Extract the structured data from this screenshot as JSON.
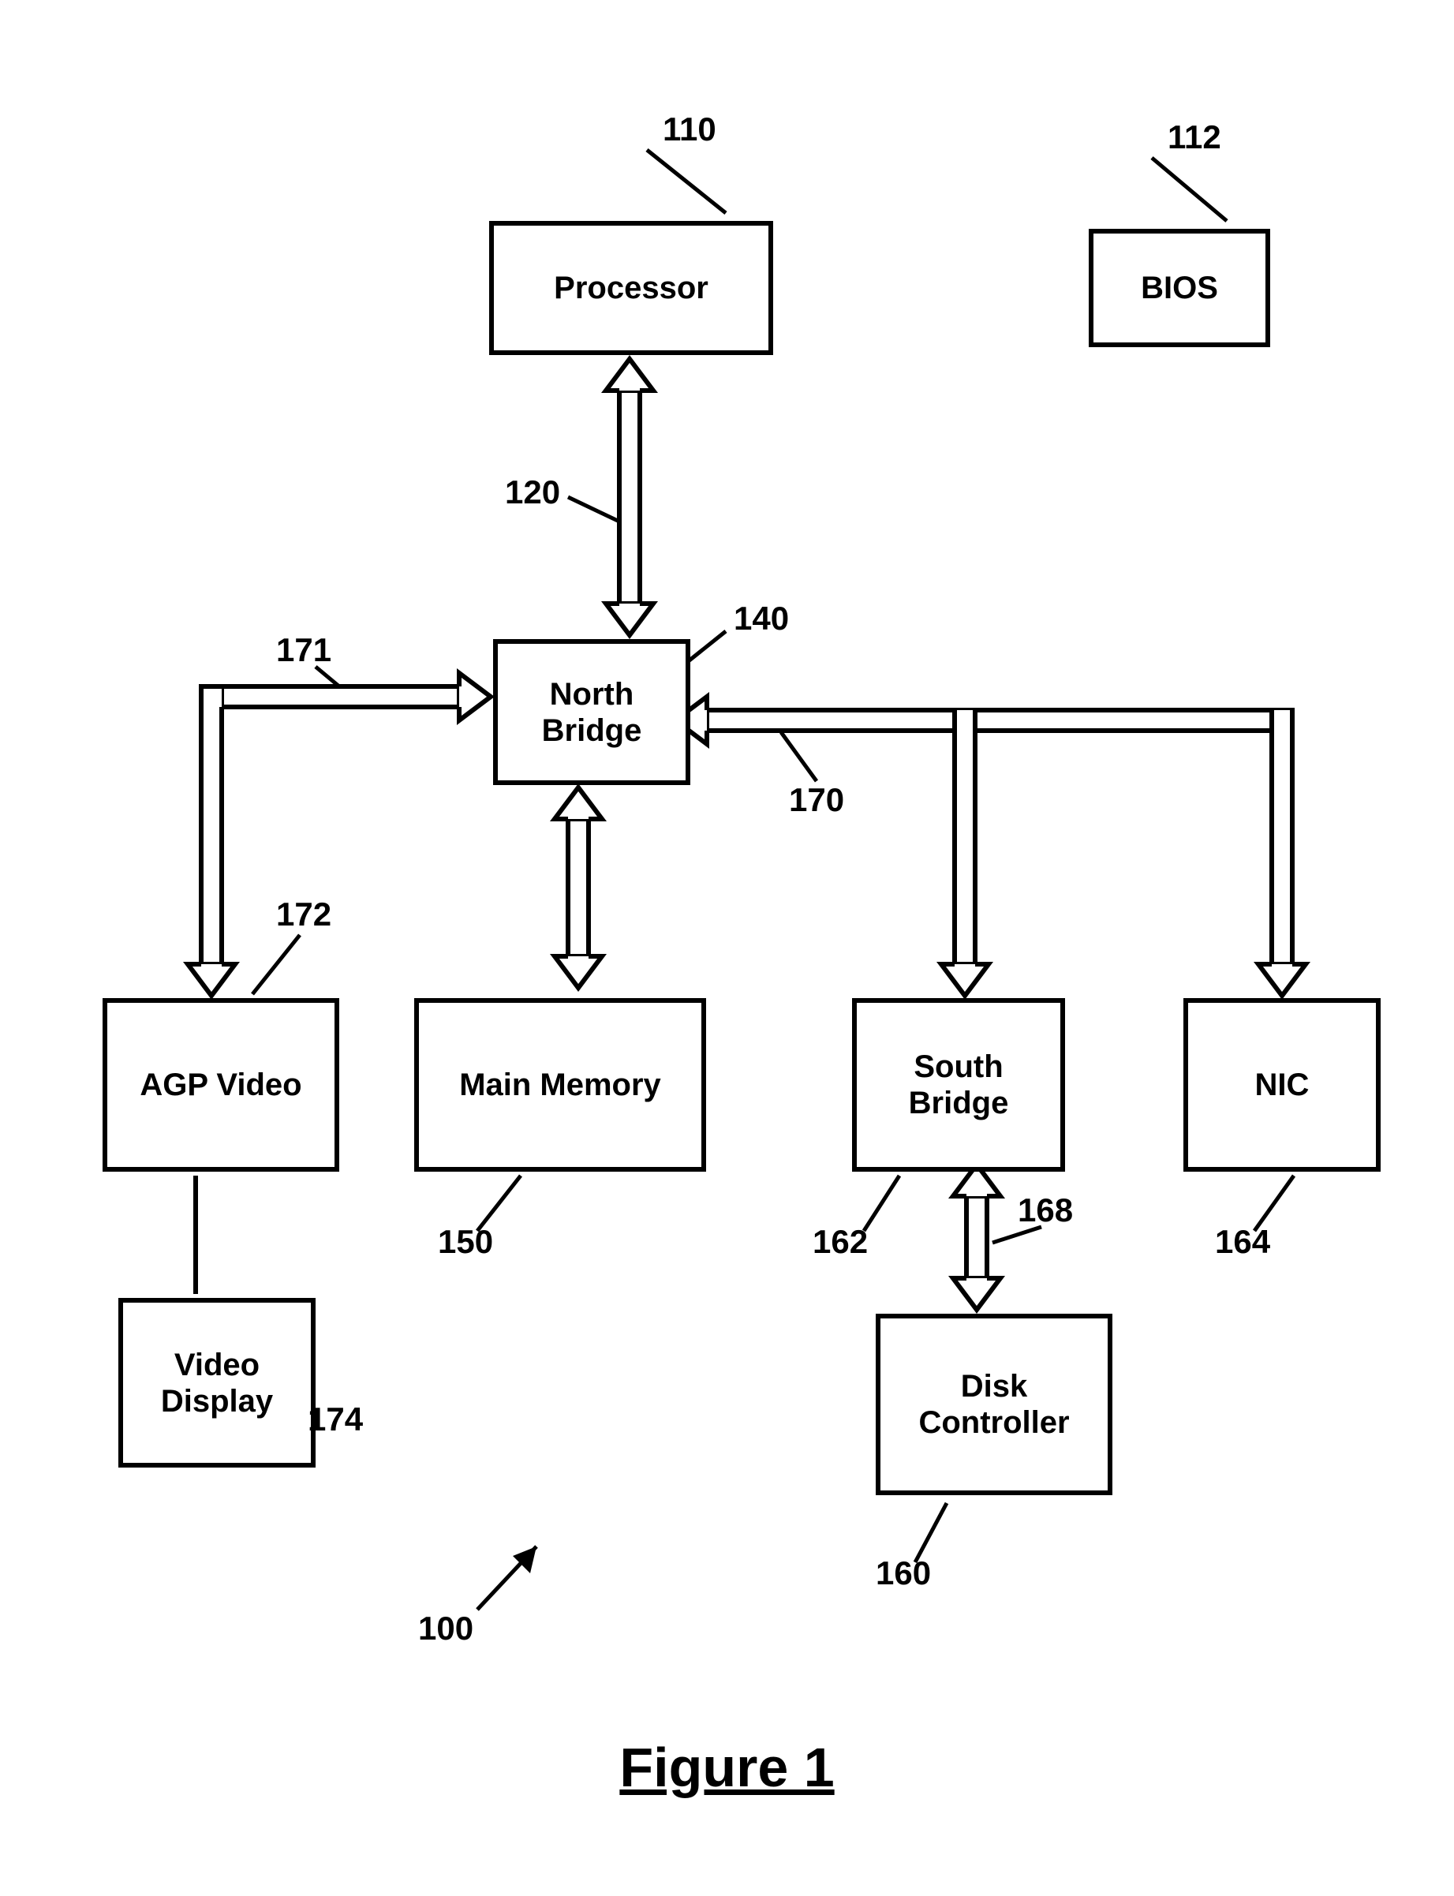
{
  "boxes": {
    "processor": "Processor",
    "bios": "BIOS",
    "north_bridge": "North\nBridge",
    "agp_video": "AGP Video",
    "main_memory": "Main Memory",
    "south_bridge": "South\nBridge",
    "nic": "NIC",
    "video_display": "Video\nDisplay",
    "disk_controller": "Disk\nController"
  },
  "refs": {
    "r110": "110",
    "r112": "112",
    "r120": "120",
    "r140": "140",
    "r150": "150",
    "r160": "160",
    "r162": "162",
    "r164": "164",
    "r168": "168",
    "r170": "170",
    "r171": "171",
    "r172": "172",
    "r174": "174",
    "r100": "100"
  },
  "figure_label": "Figure 1"
}
